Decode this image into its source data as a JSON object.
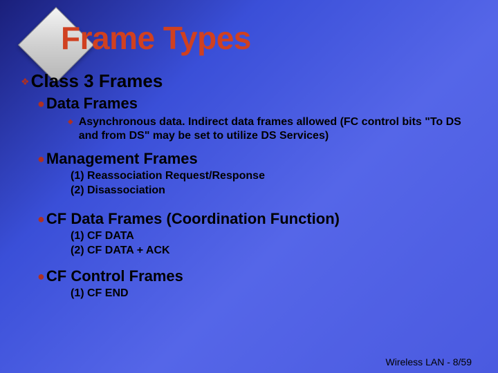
{
  "title": "Frame Types",
  "class_heading": "Class 3 Frames",
  "sections": {
    "data_frames": {
      "label": "Data Frames",
      "sub": " Asynchronous data. Indirect data frames allowed (FC control bits \"To DS and from DS\" may be set to utilize DS Services)"
    },
    "mgmt_frames": {
      "label": "Management Frames",
      "items": [
        "(1) Reassociation Request/Response",
        "(2) Disassociation"
      ]
    },
    "cf_data": {
      "label": "CF Data Frames (Coordination Function)",
      "items": [
        "(1) CF DATA",
        "(2) CF DATA + ACK"
      ]
    },
    "cf_control": {
      "label": "CF Control Frames",
      "items": [
        "(1) CF END"
      ]
    }
  },
  "footer": "Wireless LAN - 8/59"
}
